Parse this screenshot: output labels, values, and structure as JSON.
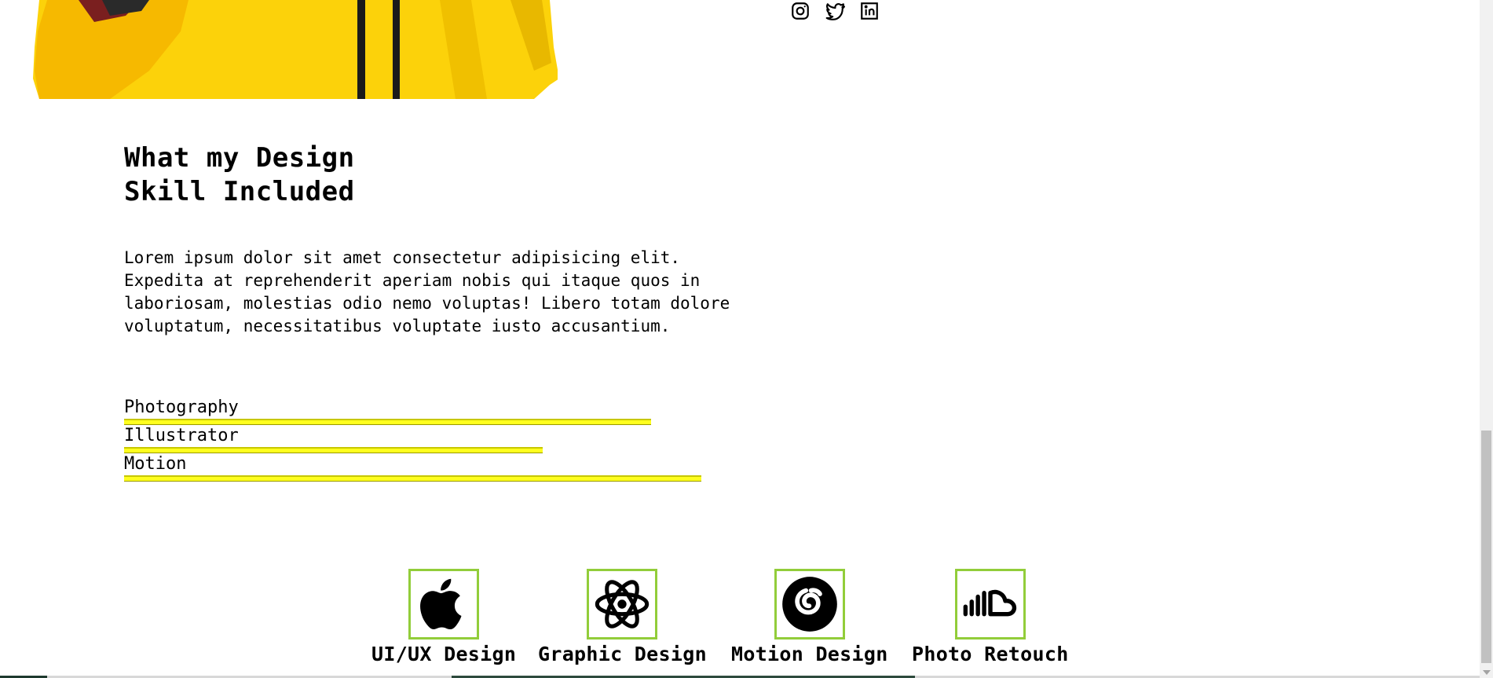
{
  "hero": {
    "image": "person-yellow-hoodie-photo"
  },
  "social": [
    {
      "name": "instagram",
      "icon": "instagram-icon"
    },
    {
      "name": "twitter",
      "icon": "twitter-icon"
    },
    {
      "name": "linkedin",
      "icon": "linkedin-icon"
    }
  ],
  "skills_section": {
    "title_line1": "What my Design",
    "title_line2": "Skill Included",
    "description": "Lorem ipsum dolor sit amet consectetur adipisicing elit. Expedita at reprehenderit aperiam nobis qui itaque quos in laboriosam, molestias odio nemo voluptas! Libero totam dolore voluptatum, necessitatibus voluptate iusto accusantium.",
    "bars": [
      {
        "label": "Photography",
        "level": 0.78
      },
      {
        "label": "Illustrator",
        "level": 0.62
      },
      {
        "label": "Motion",
        "level": 0.855
      }
    ],
    "bar_color": "#ffff1e"
  },
  "services": [
    {
      "label": "UI/UX Design",
      "icon": "apple-icon"
    },
    {
      "label": "Graphic Design",
      "icon": "react-icon"
    },
    {
      "label": "Motion Design",
      "icon": "netease-music-icon"
    },
    {
      "label": "Photo Retouch",
      "icon": "soundcloud-icon"
    }
  ],
  "accent_color": "#92cd3a"
}
